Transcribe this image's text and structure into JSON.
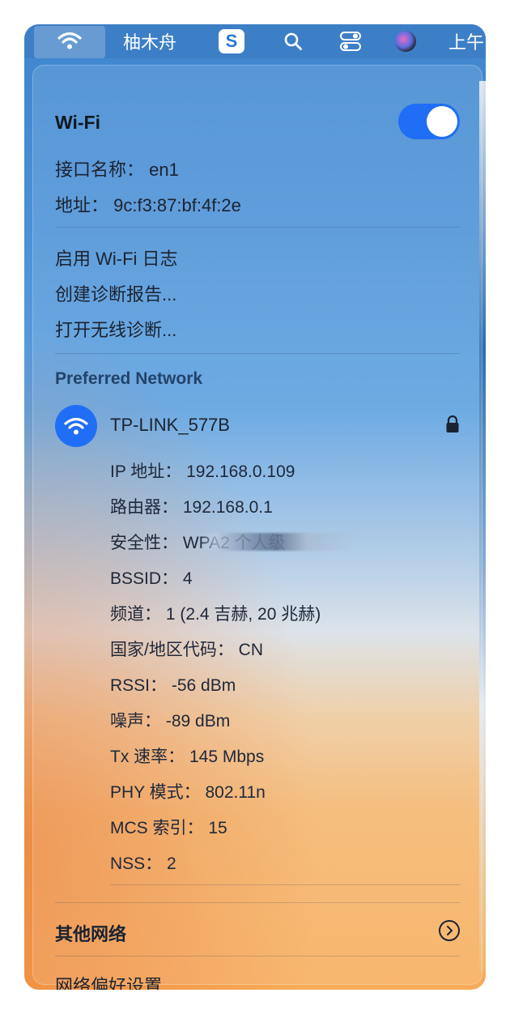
{
  "menubar": {
    "app_name": "柚木舟",
    "app_icon_letter": "S",
    "time_fragment": "上午"
  },
  "wifi": {
    "title": "Wi-Fi",
    "toggle_on": true,
    "interface_line": "接口名称：  en1",
    "address_line": "地址：  9c:f3:87:bf:4f:2e"
  },
  "actions": [
    "启用 Wi-Fi 日志",
    "创建诊断报告...",
    "打开无线诊断..."
  ],
  "preferred": {
    "section_label": "Preferred Network",
    "network_name": "TP-LINK_577B",
    "details": {
      "ip": "IP 地址：  192.168.0.109",
      "router": "路由器：  192.168.0.1",
      "security": "安全性：  WPA2 个人级",
      "bssid": "BSSID：  4",
      "channel": "频道：  1 (2.4 吉赫, 20 兆赫)",
      "country": "国家/地区代码：  CN",
      "rssi": "RSSI：  -56 dBm",
      "noise": "噪声：  -89 dBm",
      "tx_rate": "Tx 速率：  145 Mbps",
      "phy": "PHY 模式：  802.11n",
      "mcs": "MCS 索引：  15",
      "nss": "NSS：  2"
    }
  },
  "other_networks": "其他网络",
  "network_prefs": "网络偏好设置...",
  "colors": {
    "accent": "#1f6ef5",
    "menubar": "#3d7fc6"
  },
  "icons": [
    "wifi-icon",
    "search-icon",
    "control-center-icon",
    "siri-icon",
    "lock-icon",
    "chevron-right-icon"
  ]
}
